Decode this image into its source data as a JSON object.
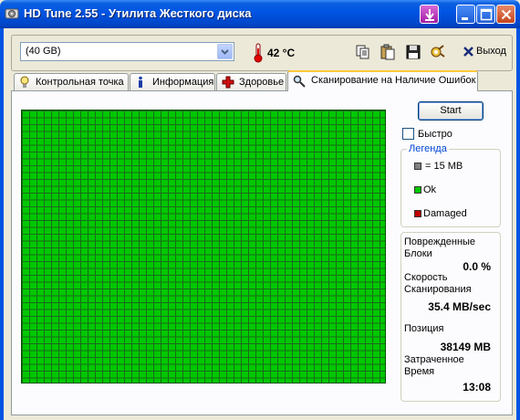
{
  "window": {
    "title": "HD Tune 2.55 - Утилита Жесткого диска"
  },
  "toolbar": {
    "drive_selected": "(40 GB)",
    "temperature": "42 °C",
    "exit_label": "Выход"
  },
  "tabs": [
    {
      "label": "Контрольная точка",
      "active": false
    },
    {
      "label": "Информация",
      "active": false
    },
    {
      "label": "Здоровье",
      "active": false
    },
    {
      "label": "Сканирование на Наличие Ошибок",
      "active": true
    }
  ],
  "scan": {
    "start_label": "Start",
    "quick_label": "Быстро",
    "quick_checked": false,
    "legend": {
      "title": "Легенда",
      "items": [
        {
          "label": "= 15 MB",
          "color": "#808080"
        },
        {
          "label": "Ok",
          "color": "#00c800"
        },
        {
          "label": "Damaged",
          "color": "#c00000"
        }
      ]
    },
    "block_color": "#00c800",
    "stats": {
      "damaged_label": "Поврежденные Блоки",
      "damaged_value": "0.0 %",
      "speed_label": "Скорость Сканирования",
      "speed_value": "35.4 MB/sec",
      "position_label": "Позиция",
      "position_value": "38149 MB",
      "time_label": "Затраченное Время",
      "time_value": "13:08"
    }
  }
}
